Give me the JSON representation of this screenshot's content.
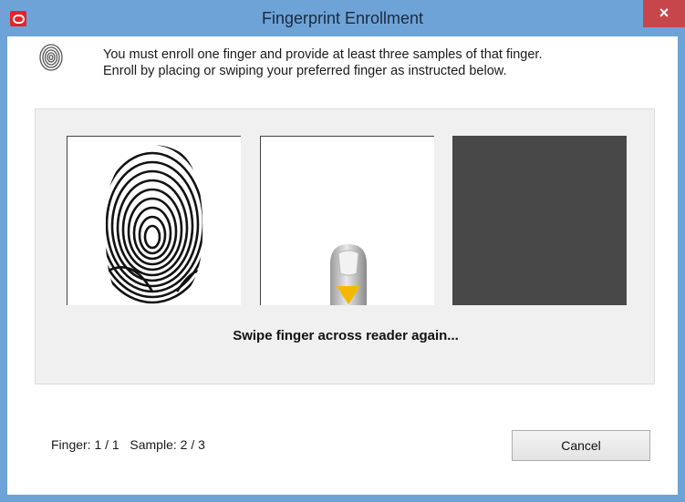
{
  "window": {
    "title": "Fingerprint Enrollment",
    "close_label": "×"
  },
  "instructions": {
    "line1": "You must enroll one finger and provide at least three samples of that finger.",
    "line2": "Enroll by placing or swiping your preferred finger as instructed below."
  },
  "samples": [
    {
      "state": "captured",
      "icon": "fingerprint-sample"
    },
    {
      "state": "prompt",
      "icon": "finger-swipe-prompt"
    },
    {
      "state": "empty",
      "icon": "empty-sample"
    }
  ],
  "status": {
    "message": "Swipe finger across reader again..."
  },
  "footer": {
    "finger_label": "Finger:",
    "finger_value": "1 / 1",
    "sample_label": "Sample:",
    "sample_value": "2 / 3",
    "cancel_label": "Cancel"
  },
  "colors": {
    "titlebar": "#6ea3d8",
    "close_button": "#c7464b",
    "empty_slot": "#484848",
    "swipe_arrow": "#f5b800"
  }
}
